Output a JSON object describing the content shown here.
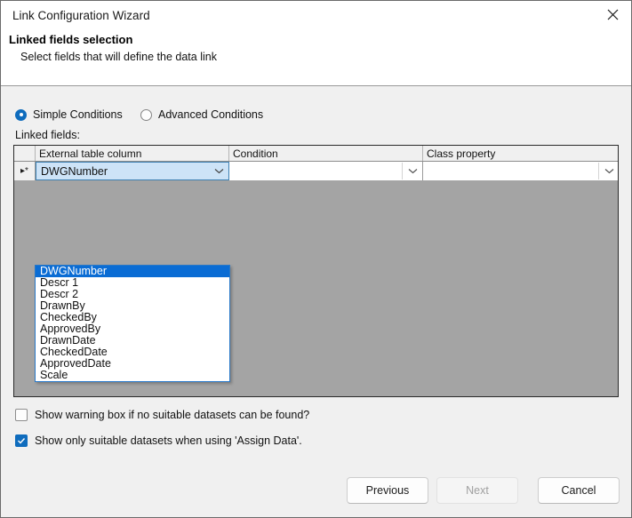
{
  "window": {
    "title": "Link Configuration Wizard",
    "close_icon": "close-icon"
  },
  "header": {
    "title": "Linked fields selection",
    "subtitle": "Select fields that will define the data link"
  },
  "conditions": {
    "options": [
      {
        "label": "Simple Conditions",
        "selected": true
      },
      {
        "label": "Advanced Conditions",
        "selected": false
      }
    ]
  },
  "grid": {
    "section_label": "Linked fields:",
    "columns": [
      {
        "label": ""
      },
      {
        "label": "External table column"
      },
      {
        "label": "Condition"
      },
      {
        "label": "Class property"
      }
    ],
    "row": {
      "indicator": "▸*",
      "external_table_column": "DWGNumber",
      "condition": "",
      "class_property": ""
    }
  },
  "dropdown": {
    "open": true,
    "selected": "DWGNumber",
    "items": [
      "DWGNumber",
      "Descr 1",
      "Descr 2",
      "DrawnBy",
      "CheckedBy",
      "ApprovedBy",
      "DrawnDate",
      "CheckedDate",
      "ApprovedDate",
      "Scale"
    ]
  },
  "checkboxes": [
    {
      "label": "Show warning box if no suitable datasets can be found?",
      "checked": false
    },
    {
      "label": "Show only suitable datasets when using 'Assign Data'.",
      "checked": true
    }
  ],
  "footer": {
    "previous_label": "Previous",
    "next_label": "Next",
    "next_disabled": true,
    "cancel_label": "Cancel"
  },
  "colors": {
    "accent": "#0f6cbd",
    "selection": "#0a6cd4",
    "cell_selected_bg": "#cde3f7",
    "grid_bg": "#a4a4a4",
    "dialog_bg": "#f0f0f0"
  }
}
